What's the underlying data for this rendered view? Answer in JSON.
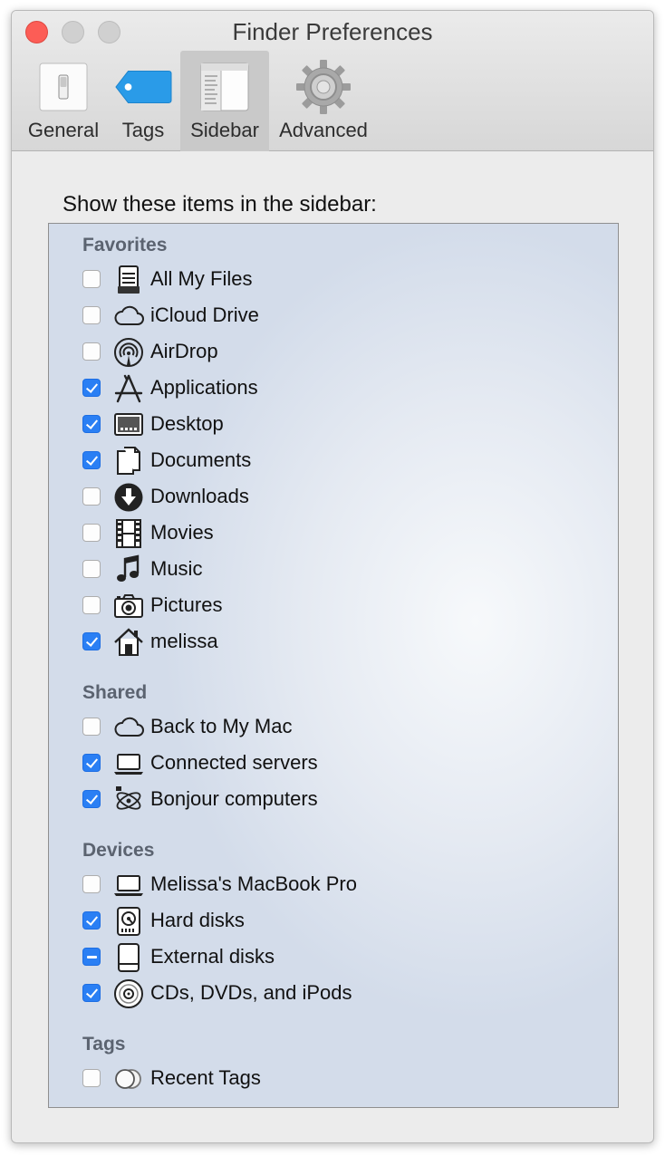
{
  "window": {
    "title": "Finder Preferences"
  },
  "tabs": [
    {
      "label": "General",
      "icon": "general-switch-icon",
      "selected": false
    },
    {
      "label": "Tags",
      "icon": "tag-icon",
      "selected": false
    },
    {
      "label": "Sidebar",
      "icon": "sidebar-icon",
      "selected": true
    },
    {
      "label": "Advanced",
      "icon": "gear-icon",
      "selected": false
    }
  ],
  "heading": "Show these items in the sidebar:",
  "sections": {
    "favorites": {
      "title": "Favorites",
      "items": [
        {
          "label": "All My Files",
          "icon": "all-my-files-icon",
          "state": "unchecked"
        },
        {
          "label": "iCloud Drive",
          "icon": "icloud-icon",
          "state": "unchecked"
        },
        {
          "label": "AirDrop",
          "icon": "airdrop-icon",
          "state": "unchecked"
        },
        {
          "label": "Applications",
          "icon": "applications-icon",
          "state": "checked"
        },
        {
          "label": "Desktop",
          "icon": "desktop-icon",
          "state": "checked"
        },
        {
          "label": "Documents",
          "icon": "documents-icon",
          "state": "checked"
        },
        {
          "label": "Downloads",
          "icon": "downloads-icon",
          "state": "unchecked"
        },
        {
          "label": "Movies",
          "icon": "movies-icon",
          "state": "unchecked"
        },
        {
          "label": "Music",
          "icon": "music-icon",
          "state": "unchecked"
        },
        {
          "label": "Pictures",
          "icon": "camera-icon",
          "state": "unchecked"
        },
        {
          "label": "melissa",
          "icon": "home-icon",
          "state": "checked"
        }
      ]
    },
    "shared": {
      "title": "Shared",
      "items": [
        {
          "label": "Back to My Mac",
          "icon": "cloud-icon",
          "state": "unchecked"
        },
        {
          "label": "Connected servers",
          "icon": "laptop-icon",
          "state": "checked"
        },
        {
          "label": "Bonjour computers",
          "icon": "bonjour-icon",
          "state": "checked"
        }
      ]
    },
    "devices": {
      "title": "Devices",
      "items": [
        {
          "label": "Melissa's MacBook Pro",
          "icon": "laptop-icon",
          "state": "unchecked"
        },
        {
          "label": "Hard disks",
          "icon": "hard-disk-icon",
          "state": "checked"
        },
        {
          "label": "External disks",
          "icon": "external-disk-icon",
          "state": "mixed"
        },
        {
          "label": "CDs, DVDs, and iPods",
          "icon": "cd-icon",
          "state": "checked"
        }
      ]
    },
    "tags": {
      "title": "Tags",
      "items": [
        {
          "label": "Recent Tags",
          "icon": "recent-tags-icon",
          "state": "unchecked"
        }
      ]
    }
  },
  "colors": {
    "accent": "#2a7ff4",
    "close": "#fc5d56",
    "tag": "#2a9be8"
  }
}
